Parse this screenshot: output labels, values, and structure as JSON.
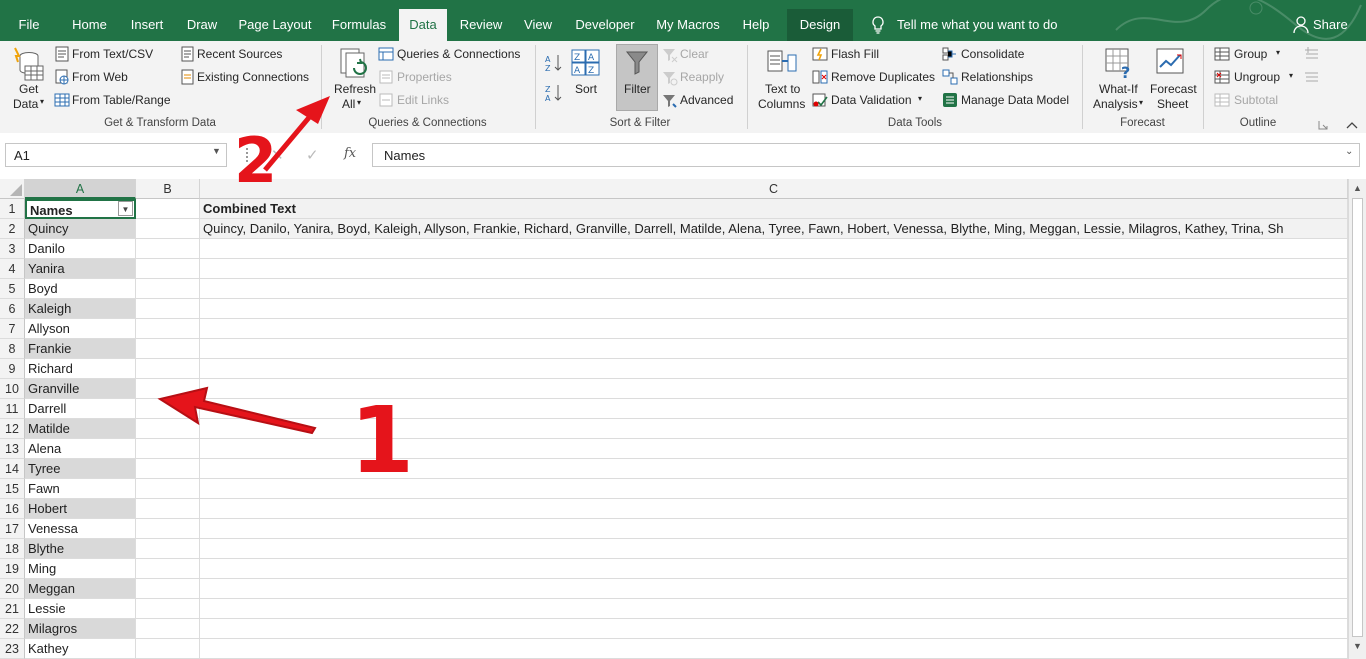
{
  "tabs": [
    "File",
    "Home",
    "Insert",
    "Draw",
    "Page Layout",
    "Formulas",
    "Data",
    "Review",
    "View",
    "Developer",
    "My Macros",
    "Help",
    "Design"
  ],
  "active_tab": "Data",
  "tell_me": "Tell me what you want to do",
  "share": "Share",
  "ribbon": {
    "get_transform": {
      "get_data": [
        "Get",
        "Data"
      ],
      "from_text_csv": "From Text/CSV",
      "from_web": "From Web",
      "from_table_range": "From Table/Range",
      "recent_sources": "Recent Sources",
      "existing_connections": "Existing Connections",
      "group_label": "Get & Transform Data"
    },
    "queries": {
      "refresh_all": [
        "Refresh",
        "All"
      ],
      "queries_connections": "Queries & Connections",
      "properties": "Properties",
      "edit_links": "Edit Links",
      "group_label": "Queries & Connections"
    },
    "sort_filter": {
      "sort": "Sort",
      "filter": "Filter",
      "clear": "Clear",
      "reapply": "Reapply",
      "advanced": "Advanced",
      "group_label": "Sort & Filter"
    },
    "data_tools": {
      "text_to_columns": [
        "Text to",
        "Columns"
      ],
      "flash_fill": "Flash Fill",
      "remove_duplicates": "Remove Duplicates",
      "data_validation": "Data Validation",
      "consolidate": "Consolidate",
      "relationships": "Relationships",
      "manage_data_model": "Manage Data Model",
      "group_label": "Data Tools"
    },
    "forecast": {
      "what_if": [
        "What-If",
        "Analysis"
      ],
      "forecast_sheet": [
        "Forecast",
        "Sheet"
      ],
      "group_label": "Forecast"
    },
    "outline": {
      "group": "Group",
      "ungroup": "Ungroup",
      "subtotal": "Subtotal",
      "group_label": "Outline"
    }
  },
  "formula_bar": {
    "name_box": "A1",
    "fx": "fx",
    "content": "Names"
  },
  "columns": [
    "A",
    "B",
    "C"
  ],
  "header_row": {
    "a": "Names",
    "c": "Combined Text"
  },
  "combined_text": "Quincy, Danilo, Yanira, Boyd, Kaleigh, Allyson, Frankie, Richard, Granville, Darrell, Matilde, Alena, Tyree, Fawn, Hobert, Venessa, Blythe, Ming, Meggan, Lessie, Milagros, Kathey, Trina, Sh",
  "names": [
    "Quincy",
    "Danilo",
    "Yanira",
    "Boyd",
    "Kaleigh",
    "Allyson",
    "Frankie",
    "Richard",
    "Granville",
    "Darrell",
    "Matilde",
    "Alena",
    "Tyree",
    "Fawn",
    "Hobert",
    "Venessa",
    "Blythe",
    "Ming",
    "Meggan",
    "Lessie",
    "Milagros",
    "Kathey"
  ],
  "row_numbers": [
    "1",
    "2",
    "3",
    "4",
    "5",
    "6",
    "7",
    "8",
    "9",
    "10",
    "11",
    "12",
    "13",
    "14",
    "15",
    "16",
    "17",
    "18",
    "19",
    "20",
    "21",
    "22",
    "23"
  ],
  "annotations": {
    "one": "1",
    "two": "2"
  },
  "colors": {
    "excel_green": "#217346",
    "band": "#d9d9d9",
    "annotation_red": "#e5141b"
  }
}
